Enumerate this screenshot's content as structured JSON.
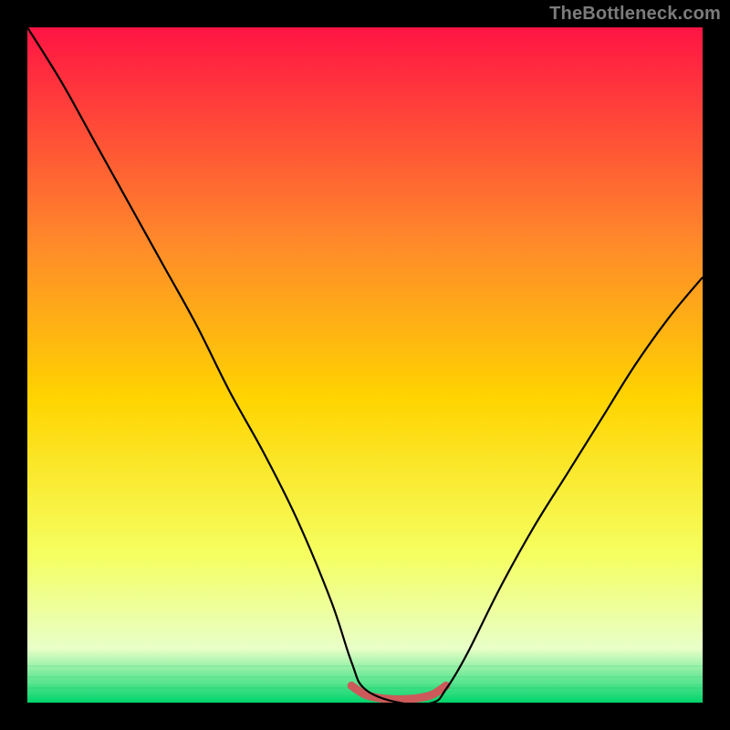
{
  "watermark": "TheBottleneck.com",
  "palette": {
    "frame": "#000000",
    "gradient_top": "#ff1444",
    "gradient_upper_mid": "#ff8a2a",
    "gradient_mid": "#ffd400",
    "gradient_lower_mid": "#f5ff60",
    "gradient_near_bottom": "#e8ffc8",
    "gradient_bottom": "#00d46b",
    "curve": "#000000",
    "marker": "#cc5a5a"
  },
  "chart_data": {
    "type": "line",
    "title": "",
    "xlabel": "",
    "ylabel": "",
    "xlim": [
      0,
      100
    ],
    "ylim": [
      0,
      100
    ],
    "series": [
      {
        "name": "main-curve",
        "x": [
          0,
          5,
          10,
          15,
          20,
          25,
          30,
          35,
          40,
          45,
          48,
          50,
          55,
          60,
          62,
          65,
          70,
          75,
          80,
          85,
          90,
          95,
          100
        ],
        "y": [
          100,
          92,
          83,
          74,
          65,
          56,
          46,
          37,
          27,
          15,
          6,
          2,
          0,
          0,
          2,
          7,
          17,
          26,
          34,
          42,
          50,
          57,
          63
        ]
      },
      {
        "name": "bottom-marker-band",
        "x": [
          48,
          50,
          52,
          54,
          56,
          58,
          60,
          62
        ],
        "y": [
          2.5,
          1.2,
          0.7,
          0.5,
          0.5,
          0.7,
          1.2,
          2.5
        ]
      }
    ],
    "notes": "No axis ticks or numeric labels are visible; x and y are normalized 0–100. y=0 corresponds to the bottom green band."
  }
}
